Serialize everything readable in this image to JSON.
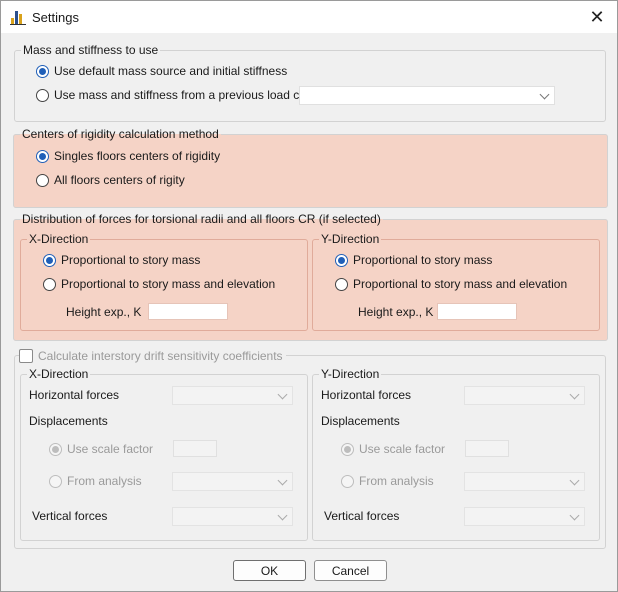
{
  "window": {
    "title": "Settings"
  },
  "mass": {
    "legend": "Mass and stiffness to use",
    "option_default": "Use default mass source and initial stiffness",
    "option_previous": "Use mass and stiffness from a previous load case",
    "selected": "option_default",
    "previous_case_value": ""
  },
  "rigidity": {
    "legend": "Centers of rigidity calculation method",
    "option_single": "Singles floors centers of rigidity",
    "option_all": "All floors centers of rigity",
    "selected": "option_single"
  },
  "torsion": {
    "legend": "Distribution of forces for torsional radii and all floors CR (if selected)",
    "x": {
      "legend": "X-Direction",
      "option_mass": "Proportional to story mass",
      "option_mass_elev": "Proportional to story mass and elevation",
      "height_label": "Height exp., K",
      "height_value": "",
      "selected": "option_mass"
    },
    "y": {
      "legend": "Y-Direction",
      "option_mass": "Proportional to story mass",
      "option_mass_elev": "Proportional to story mass and elevation",
      "height_label": "Height exp., K",
      "height_value": "",
      "selected": "option_mass"
    }
  },
  "drift": {
    "checkbox_label": "Calculate interstory drift sensitivity coefficients",
    "checked": false,
    "x": {
      "legend": "X-Direction",
      "horizontal_label": "Horizontal forces",
      "displacements_label": "Displacements",
      "scale_label": "Use scale factor",
      "analysis_label": "From analysis",
      "vertical_label": "Vertical forces"
    },
    "y": {
      "legend": "Y-Direction",
      "horizontal_label": "Horizontal forces",
      "displacements_label": "Displacements",
      "scale_label": "Use scale factor",
      "analysis_label": "From analysis",
      "vertical_label": "Vertical forces"
    }
  },
  "buttons": {
    "ok": "OK",
    "cancel": "Cancel"
  },
  "colors": {
    "highlight": "#f5d3c6",
    "accent": "#1f5fb8"
  }
}
